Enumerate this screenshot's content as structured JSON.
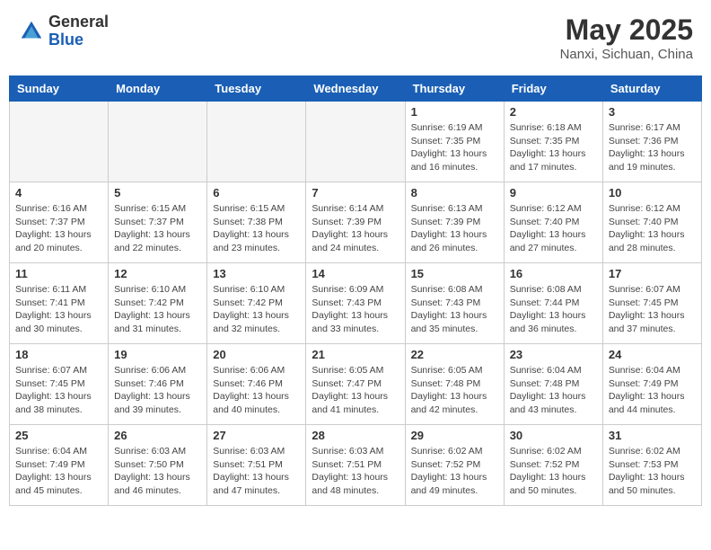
{
  "header": {
    "logo_general": "General",
    "logo_blue": "Blue",
    "month_year": "May 2025",
    "location": "Nanxi, Sichuan, China"
  },
  "weekdays": [
    "Sunday",
    "Monday",
    "Tuesday",
    "Wednesday",
    "Thursday",
    "Friday",
    "Saturday"
  ],
  "weeks": [
    [
      {
        "day": "",
        "info": ""
      },
      {
        "day": "",
        "info": ""
      },
      {
        "day": "",
        "info": ""
      },
      {
        "day": "",
        "info": ""
      },
      {
        "day": "1",
        "info": "Sunrise: 6:19 AM\nSunset: 7:35 PM\nDaylight: 13 hours\nand 16 minutes."
      },
      {
        "day": "2",
        "info": "Sunrise: 6:18 AM\nSunset: 7:35 PM\nDaylight: 13 hours\nand 17 minutes."
      },
      {
        "day": "3",
        "info": "Sunrise: 6:17 AM\nSunset: 7:36 PM\nDaylight: 13 hours\nand 19 minutes."
      }
    ],
    [
      {
        "day": "4",
        "info": "Sunrise: 6:16 AM\nSunset: 7:37 PM\nDaylight: 13 hours\nand 20 minutes."
      },
      {
        "day": "5",
        "info": "Sunrise: 6:15 AM\nSunset: 7:37 PM\nDaylight: 13 hours\nand 22 minutes."
      },
      {
        "day": "6",
        "info": "Sunrise: 6:15 AM\nSunset: 7:38 PM\nDaylight: 13 hours\nand 23 minutes."
      },
      {
        "day": "7",
        "info": "Sunrise: 6:14 AM\nSunset: 7:39 PM\nDaylight: 13 hours\nand 24 minutes."
      },
      {
        "day": "8",
        "info": "Sunrise: 6:13 AM\nSunset: 7:39 PM\nDaylight: 13 hours\nand 26 minutes."
      },
      {
        "day": "9",
        "info": "Sunrise: 6:12 AM\nSunset: 7:40 PM\nDaylight: 13 hours\nand 27 minutes."
      },
      {
        "day": "10",
        "info": "Sunrise: 6:12 AM\nSunset: 7:40 PM\nDaylight: 13 hours\nand 28 minutes."
      }
    ],
    [
      {
        "day": "11",
        "info": "Sunrise: 6:11 AM\nSunset: 7:41 PM\nDaylight: 13 hours\nand 30 minutes."
      },
      {
        "day": "12",
        "info": "Sunrise: 6:10 AM\nSunset: 7:42 PM\nDaylight: 13 hours\nand 31 minutes."
      },
      {
        "day": "13",
        "info": "Sunrise: 6:10 AM\nSunset: 7:42 PM\nDaylight: 13 hours\nand 32 minutes."
      },
      {
        "day": "14",
        "info": "Sunrise: 6:09 AM\nSunset: 7:43 PM\nDaylight: 13 hours\nand 33 minutes."
      },
      {
        "day": "15",
        "info": "Sunrise: 6:08 AM\nSunset: 7:43 PM\nDaylight: 13 hours\nand 35 minutes."
      },
      {
        "day": "16",
        "info": "Sunrise: 6:08 AM\nSunset: 7:44 PM\nDaylight: 13 hours\nand 36 minutes."
      },
      {
        "day": "17",
        "info": "Sunrise: 6:07 AM\nSunset: 7:45 PM\nDaylight: 13 hours\nand 37 minutes."
      }
    ],
    [
      {
        "day": "18",
        "info": "Sunrise: 6:07 AM\nSunset: 7:45 PM\nDaylight: 13 hours\nand 38 minutes."
      },
      {
        "day": "19",
        "info": "Sunrise: 6:06 AM\nSunset: 7:46 PM\nDaylight: 13 hours\nand 39 minutes."
      },
      {
        "day": "20",
        "info": "Sunrise: 6:06 AM\nSunset: 7:46 PM\nDaylight: 13 hours\nand 40 minutes."
      },
      {
        "day": "21",
        "info": "Sunrise: 6:05 AM\nSunset: 7:47 PM\nDaylight: 13 hours\nand 41 minutes."
      },
      {
        "day": "22",
        "info": "Sunrise: 6:05 AM\nSunset: 7:48 PM\nDaylight: 13 hours\nand 42 minutes."
      },
      {
        "day": "23",
        "info": "Sunrise: 6:04 AM\nSunset: 7:48 PM\nDaylight: 13 hours\nand 43 minutes."
      },
      {
        "day": "24",
        "info": "Sunrise: 6:04 AM\nSunset: 7:49 PM\nDaylight: 13 hours\nand 44 minutes."
      }
    ],
    [
      {
        "day": "25",
        "info": "Sunrise: 6:04 AM\nSunset: 7:49 PM\nDaylight: 13 hours\nand 45 minutes."
      },
      {
        "day": "26",
        "info": "Sunrise: 6:03 AM\nSunset: 7:50 PM\nDaylight: 13 hours\nand 46 minutes."
      },
      {
        "day": "27",
        "info": "Sunrise: 6:03 AM\nSunset: 7:51 PM\nDaylight: 13 hours\nand 47 minutes."
      },
      {
        "day": "28",
        "info": "Sunrise: 6:03 AM\nSunset: 7:51 PM\nDaylight: 13 hours\nand 48 minutes."
      },
      {
        "day": "29",
        "info": "Sunrise: 6:02 AM\nSunset: 7:52 PM\nDaylight: 13 hours\nand 49 minutes."
      },
      {
        "day": "30",
        "info": "Sunrise: 6:02 AM\nSunset: 7:52 PM\nDaylight: 13 hours\nand 50 minutes."
      },
      {
        "day": "31",
        "info": "Sunrise: 6:02 AM\nSunset: 7:53 PM\nDaylight: 13 hours\nand 50 minutes."
      }
    ]
  ]
}
